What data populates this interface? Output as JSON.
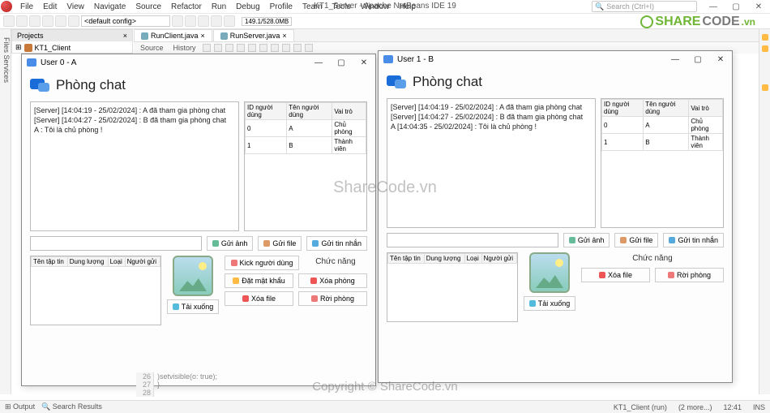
{
  "ide": {
    "title": "KT1_Server - Apache NetBeans IDE 19",
    "menu": [
      "File",
      "Edit",
      "View",
      "Navigate",
      "Source",
      "Refactor",
      "Run",
      "Debug",
      "Profile",
      "Team",
      "Tools",
      "Window",
      "Help"
    ],
    "search_placeholder": "Search (Ctrl+I)",
    "config": "<default config>",
    "memory": "149.1/528.0MB",
    "projects_tab": "Projects",
    "project_name": "KT1_Client",
    "editor_tabs": [
      "RunClient.java",
      "RunServer.java"
    ],
    "editor_sub": [
      "Source",
      "History"
    ],
    "side_left": [
      "Files",
      "Services"
    ],
    "code_lines": [
      {
        "n": 26,
        "t": ")setvisible(o: true);"
      },
      {
        "n": 27,
        "t": "}"
      },
      {
        "n": 28,
        "t": ""
      }
    ],
    "status_left": [
      "Output",
      "Search Results"
    ],
    "status_right": {
      "run": "KT1_Client (run)",
      "more": "(2 more...)",
      "pos": "12:41",
      "ins": "INS"
    }
  },
  "watermark": {
    "center": "ShareCode.vn",
    "bottom": "Copyright © ShareCode.vn",
    "brand1": "SHARE",
    "brand2": "CODE",
    "brand3": ".vn"
  },
  "winA": {
    "title": "User 0 - A",
    "heading": "Phòng chat",
    "log": [
      "[Server] [14:04:19 - 25/02/2024] : A đã tham gia phòng chat",
      "[Server] [14:04:27 - 25/02/2024] : B đã tham gia phòng chat",
      "A : Tôi là chủ phòng !"
    ],
    "user_cols": [
      "ID người dùng",
      "Tên người dùng",
      "Vai trò"
    ],
    "users": [
      [
        "0",
        "A",
        "Chủ phòng"
      ],
      [
        "1",
        "B",
        "Thành viên"
      ]
    ],
    "btn_img": "Gửi ảnh",
    "btn_file": "Gửi file",
    "btn_send": "Gửi tin nhắn",
    "file_cols": [
      "Tên tập tin",
      "Dung lượng",
      "Loại",
      "Người gửi"
    ],
    "func": "Chức năng",
    "btn_kick": "Kick người dùng",
    "btn_pass": "Đặt mật khẩu",
    "btn_delroom": "Xóa phòng",
    "btn_delfile": "Xóa file",
    "btn_leave": "Rời phòng",
    "btn_down": "Tải xuống"
  },
  "winB": {
    "title": "User 1 - B",
    "heading": "Phòng chat",
    "log": [
      "[Server] [14:04:19 - 25/02/2024] : A đã tham gia phòng chat",
      "[Server] [14:04:27 - 25/02/2024] : B đã tham gia phòng chat",
      "A [14:04:35 - 25/02/2024] : Tôi là chủ phòng !"
    ],
    "user_cols": [
      "ID người dùng",
      "Tên người dùng",
      "Vai trò"
    ],
    "users": [
      [
        "0",
        "A",
        "Chủ phòng"
      ],
      [
        "1",
        "B",
        "Thành viên"
      ]
    ],
    "btn_img": "Gửi ảnh",
    "btn_file": "Gửi file",
    "btn_send": "Gửi tin nhắn",
    "file_cols": [
      "Tên tập tin",
      "Dung lượng",
      "Loại",
      "Người gửi"
    ],
    "func": "Chức năng",
    "btn_delfile": "Xóa file",
    "btn_leave": "Rời phòng",
    "btn_down": "Tải xuống"
  }
}
